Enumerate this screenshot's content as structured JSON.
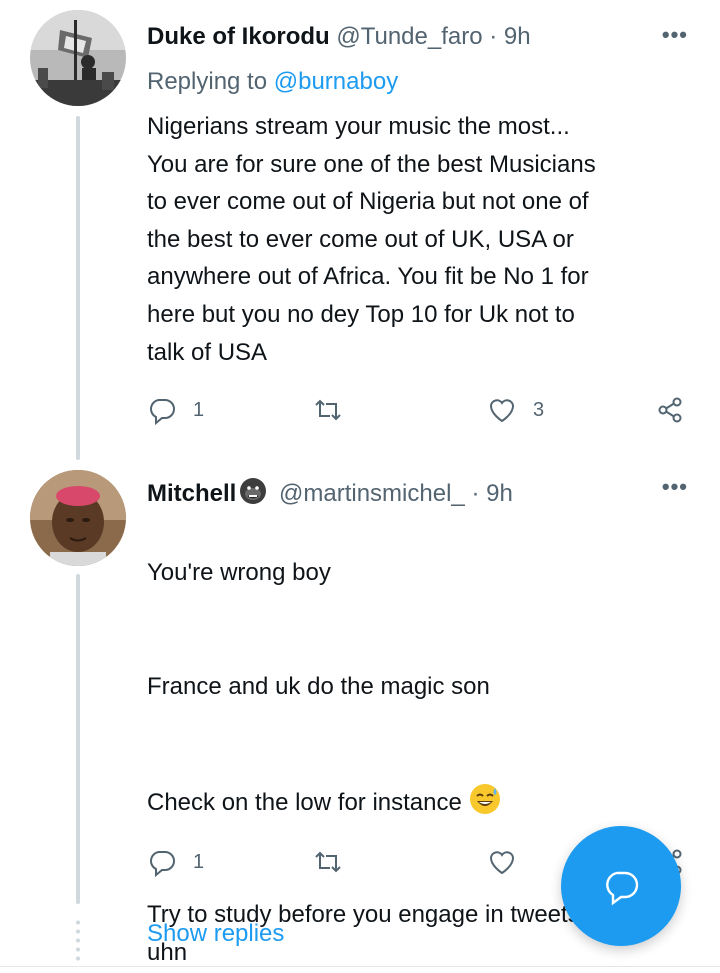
{
  "tweets": [
    {
      "name": "Duke of Ikorodu",
      "handle": "@Tunde_faro",
      "separator": "·",
      "time": "9h",
      "replying_prefix": "Replying to ",
      "replying_to": "@burnaboy",
      "text": "Nigerians stream your music the most...\nYou are for sure one of the best Musicians\nto ever come out of Nigeria but not one of\nthe best to ever come out of UK, USA or\nanywhere out of Africa. You fit be No 1 for\nhere but you no dey Top 10 for Uk not to\ntalk of USA",
      "reply_count": "1",
      "retweet_count": "",
      "like_count": "3",
      "more": "•••",
      "icons": {
        "avatar": "avatar-photo",
        "reply": "reply-icon",
        "retweet": "retweet-icon",
        "like": "heart-icon",
        "share": "share-icon"
      }
    },
    {
      "name": "Mitchell",
      "name_emoji": "gorilla-emoji",
      "handle": "@martinsmichel_",
      "separator": "·",
      "time": "9h",
      "text_lines": [
        "You're wrong boy",
        "France and uk do the magic son",
        "Check on the low for instance",
        "Try to study before you engage in tweets\nuhn"
      ],
      "line3_emoji": "sweat-smile-emoji",
      "reply_count": "1",
      "retweet_count": "",
      "like_count": "",
      "more": "•••"
    }
  ],
  "show_replies": "Show replies",
  "fab": {
    "icon": "compose-reply-icon"
  },
  "colors": {
    "accent": "#1d9bf0",
    "muted": "#536471",
    "text": "#0f1419",
    "line": "#cfd9de"
  }
}
